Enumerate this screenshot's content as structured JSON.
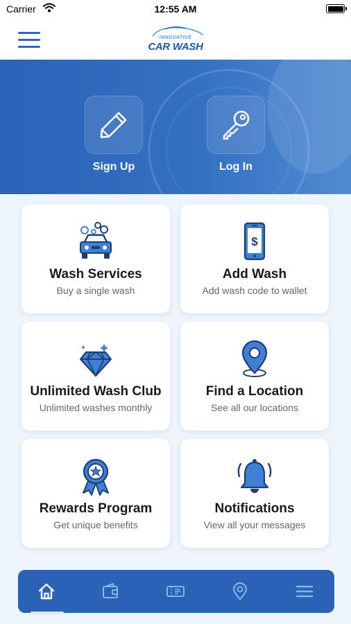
{
  "status_bar": {
    "carrier": "Carrier",
    "time": "12:55 AM"
  },
  "header": {
    "logo_top": "INNOVATIVE",
    "logo_main": "CAR WASH",
    "icons": {
      "menu": "hamburger-icon"
    }
  },
  "hero": {
    "sign_up": {
      "label": "Sign Up",
      "icon": "pencil-icon"
    },
    "log_in": {
      "label": "Log In",
      "icon": "key-icon"
    }
  },
  "cards": [
    {
      "title": "Wash Services",
      "subtitle": "Buy a single wash",
      "icon": "car-wash-icon"
    },
    {
      "title": "Add Wash",
      "subtitle": "Add wash code to wallet",
      "icon": "phone-dollar-icon"
    },
    {
      "title": "Unlimited Wash Club",
      "subtitle": "Unlimited washes monthly",
      "icon": "diamond-icon"
    },
    {
      "title": "Find a Location",
      "subtitle": "See all our locations",
      "icon": "location-pin-icon"
    },
    {
      "title": "Rewards Program",
      "subtitle": "Get unique benefits",
      "icon": "award-ribbon-icon"
    },
    {
      "title": "Notifications",
      "subtitle": "View all your messages",
      "icon": "bell-icon"
    }
  ],
  "bottom_nav": {
    "items": [
      "home-icon",
      "wallet-icon",
      "ticket-icon",
      "location-icon",
      "menu-icon"
    ],
    "active_index": 0
  },
  "colors": {
    "primary": "#2a62b8",
    "accent": "#3f7fd4",
    "background": "#eef5fc",
    "card": "#ffffff"
  }
}
